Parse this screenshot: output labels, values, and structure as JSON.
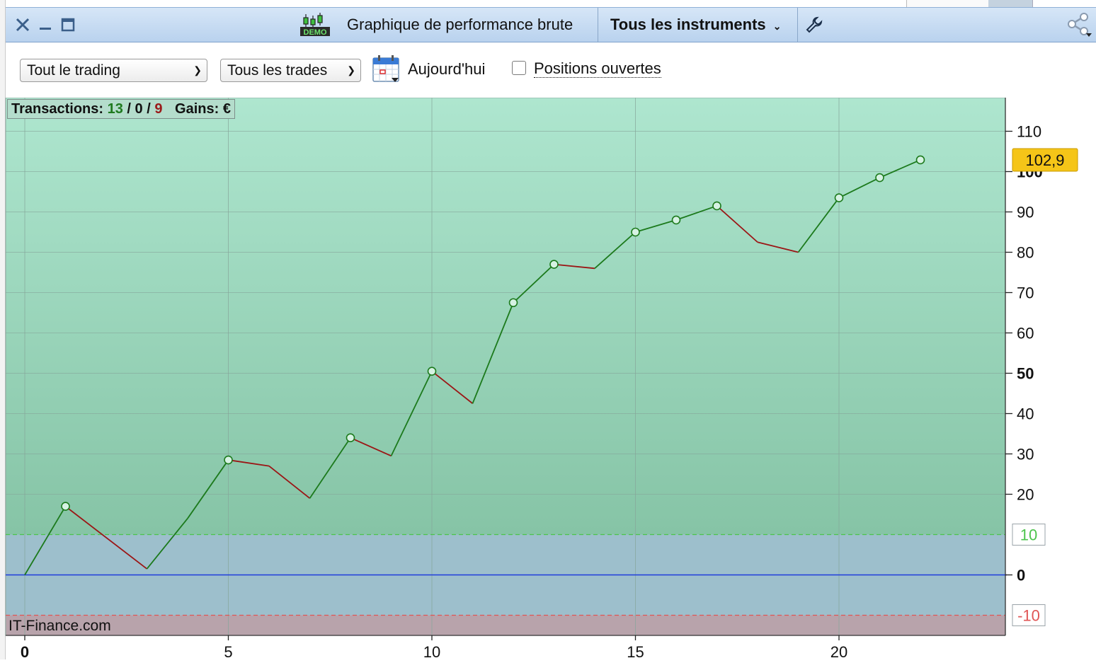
{
  "window": {
    "title": "Graphique de performance brute",
    "instrument_filter": "Tous les instruments",
    "demo_badge": "DEMO"
  },
  "filters": {
    "period": "Tout le trading",
    "trades": "Tous les trades",
    "date_label": "Aujourd'hui",
    "open_positions_label": "Positions ouvertes",
    "open_positions_checked": false
  },
  "stats": {
    "transactions_label": "Transactions:",
    "wins": "13",
    "neutral": "0",
    "losses": "9",
    "gains_label": "Gains:",
    "currency": "€"
  },
  "watermark": "IT-Finance.com",
  "colors": {
    "up": "#1c7a1c",
    "down": "#9b1515",
    "zero_line": "#1f3ddb",
    "upper_threshold": "#4cc44c",
    "lower_threshold": "#e05555",
    "last_value_badge": "#f5c518",
    "profit_zone_top": "#aee6cf",
    "profit_zone_bottom": "#86c4a6",
    "neutral_zone": "#9dbfcc",
    "loss_zone": "#b8a3ab"
  },
  "chart_data": {
    "type": "line",
    "x": [
      0,
      1,
      3,
      4,
      5,
      6,
      7,
      8,
      9,
      10,
      11,
      12,
      13,
      14,
      15,
      16,
      17,
      18,
      19,
      20,
      21,
      22
    ],
    "y": [
      0,
      17,
      1.5,
      14,
      28.5,
      27,
      19,
      34,
      29.5,
      50.5,
      42.5,
      67.5,
      77,
      76,
      85,
      88,
      91.5,
      82.5,
      80,
      93.5,
      98.5,
      102.9
    ],
    "markers_at_x": [
      1,
      5,
      8,
      10,
      12,
      13,
      15,
      16,
      17,
      20,
      21,
      22
    ],
    "x_ticks": [
      0,
      5,
      10,
      15,
      20
    ],
    "y_ticks": [
      0,
      20,
      30,
      40,
      50,
      60,
      70,
      80,
      90,
      100,
      110
    ],
    "xlim": [
      -0.5,
      24
    ],
    "ylim": [
      -15,
      115
    ],
    "thresholds": {
      "upper": 10,
      "lower": -10
    },
    "last_value_label": "102,9",
    "grid": true
  }
}
